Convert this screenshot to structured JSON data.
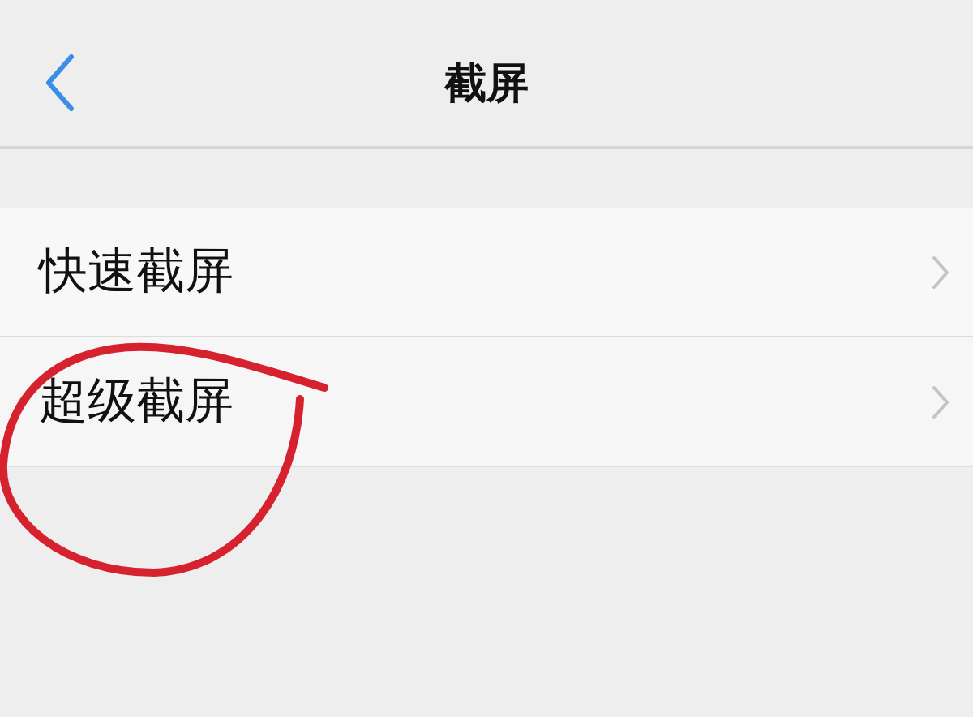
{
  "header": {
    "title": "截屏"
  },
  "items": [
    {
      "label": "快速截屏",
      "highlighted": false
    },
    {
      "label": "超级截屏",
      "highlighted": true
    }
  ]
}
